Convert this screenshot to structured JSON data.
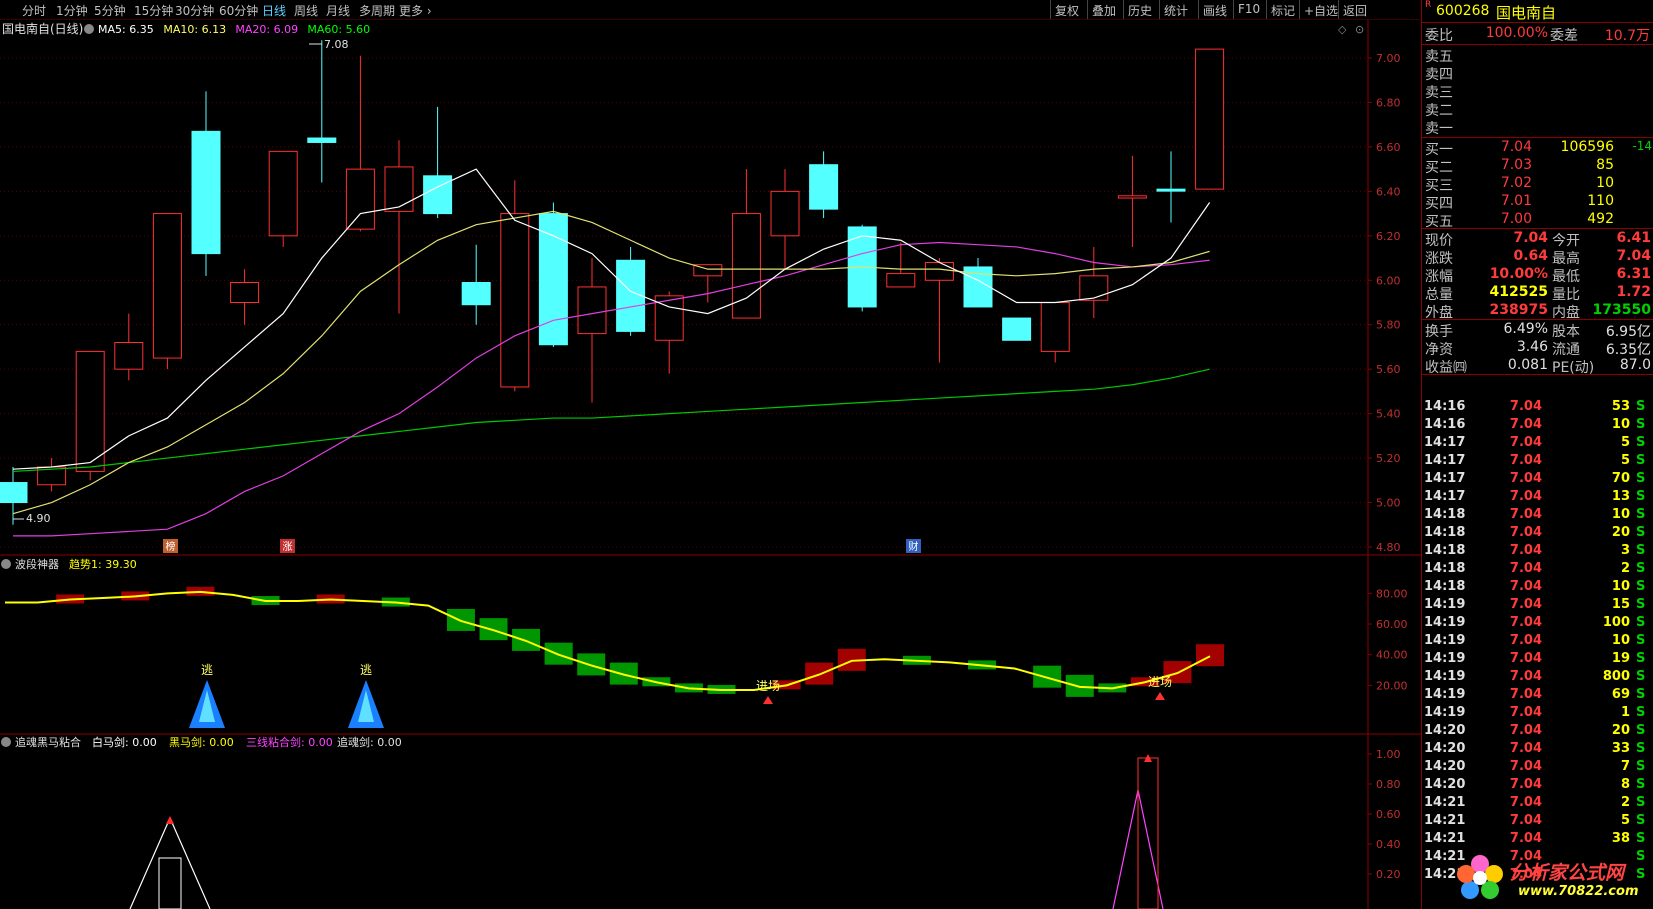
{
  "toolbar": {
    "tabs": [
      "分时",
      "1分钟",
      "5分钟",
      "15分钟",
      "30分钟",
      "60分钟",
      "日线",
      "周线",
      "月线",
      "多周期",
      "更多"
    ],
    "active_tab": "日线",
    "right_buttons": [
      "复权",
      "叠加",
      "历史",
      "统计",
      "画线",
      "F10",
      "标记",
      "+自选",
      "返回"
    ]
  },
  "main_chart": {
    "title": "国电南自(日线)",
    "ma_labels": [
      {
        "text": "MA5: 6.35",
        "color": "#ffffff"
      },
      {
        "text": "MA10: 6.13",
        "color": "#ffff66"
      },
      {
        "text": "MA20: 6.09",
        "color": "#ff44ff"
      },
      {
        "text": "MA60: 5.60",
        "color": "#00ff00"
      }
    ],
    "high_marker": "7.08",
    "low_marker": "4.90",
    "y_ticks": [
      "7.00",
      "6.80",
      "6.60",
      "6.40",
      "6.20",
      "6.00",
      "5.80",
      "5.60",
      "5.40",
      "5.20",
      "5.00",
      "4.80"
    ],
    "flags": [
      "榜",
      "涨",
      "财"
    ]
  },
  "indicator1": {
    "name": "波段神器",
    "value_label": "趋势1: 39.30",
    "y_ticks": [
      "80.00",
      "60.00",
      "40.00",
      "20.00"
    ],
    "signals": [
      "逃",
      "逃",
      "进场",
      "进场"
    ]
  },
  "indicator2": {
    "name": "追魂黑马粘合",
    "values": [
      {
        "text": "白马剑: 0.00",
        "color": "#ffffff"
      },
      {
        "text": "黑马剑: 0.00",
        "color": "#ffff00"
      },
      {
        "text": "三线粘合剑: 0.00",
        "color": "#ff44ff"
      },
      {
        "text": "追魂剑: 0.00",
        "color": "#e0e0e0"
      }
    ],
    "y_ticks": [
      "1.00",
      "0.80",
      "0.60",
      "0.40",
      "0.20"
    ]
  },
  "chart_data": {
    "type": "candlestick",
    "title": "国电南自(日线)",
    "candles": [
      {
        "o": 5.09,
        "h": 5.16,
        "l": 4.9,
        "c": 5.0,
        "up": false
      },
      {
        "o": 5.08,
        "h": 5.2,
        "l": 5.05,
        "c": 5.16,
        "up": true
      },
      {
        "o": 5.14,
        "h": 5.3,
        "l": 5.1,
        "c": 5.68,
        "up": true
      },
      {
        "o": 5.6,
        "h": 5.85,
        "l": 5.55,
        "c": 5.72,
        "up": true
      },
      {
        "o": 5.65,
        "h": 6.2,
        "l": 5.6,
        "c": 6.3,
        "up": true
      },
      {
        "o": 6.67,
        "h": 6.85,
        "l": 6.02,
        "c": 6.12,
        "up": false
      },
      {
        "o": 5.9,
        "h": 6.05,
        "l": 5.8,
        "c": 5.99,
        "up": true
      },
      {
        "o": 6.2,
        "h": 6.58,
        "l": 6.15,
        "c": 6.58,
        "up": true
      },
      {
        "o": 6.64,
        "h": 7.08,
        "l": 6.44,
        "c": 6.62,
        "up": false
      },
      {
        "o": 6.23,
        "h": 7.01,
        "l": 6.22,
        "c": 6.5,
        "up": true
      },
      {
        "o": 6.31,
        "h": 6.63,
        "l": 5.85,
        "c": 6.51,
        "up": true
      },
      {
        "o": 6.47,
        "h": 6.78,
        "l": 6.28,
        "c": 6.3,
        "up": false
      },
      {
        "o": 5.99,
        "h": 6.16,
        "l": 5.8,
        "c": 5.89,
        "up": false
      },
      {
        "o": 5.52,
        "h": 6.45,
        "l": 5.5,
        "c": 6.3,
        "up": true
      },
      {
        "o": 6.3,
        "h": 6.35,
        "l": 5.7,
        "c": 5.71,
        "up": false
      },
      {
        "o": 5.76,
        "h": 6.1,
        "l": 5.45,
        "c": 5.97,
        "up": true
      },
      {
        "o": 6.09,
        "h": 6.15,
        "l": 5.75,
        "c": 5.77,
        "up": false
      },
      {
        "o": 5.73,
        "h": 5.95,
        "l": 5.58,
        "c": 5.93,
        "up": true
      },
      {
        "o": 6.02,
        "h": 6.07,
        "l": 5.9,
        "c": 6.07,
        "up": true
      },
      {
        "o": 5.83,
        "h": 6.5,
        "l": 5.83,
        "c": 6.3,
        "up": true
      },
      {
        "o": 6.2,
        "h": 6.5,
        "l": 6.05,
        "c": 6.4,
        "up": true
      },
      {
        "o": 6.52,
        "h": 6.58,
        "l": 6.28,
        "c": 6.32,
        "up": false
      },
      {
        "o": 6.24,
        "h": 6.25,
        "l": 5.86,
        "c": 5.88,
        "up": false
      },
      {
        "o": 5.97,
        "h": 6.17,
        "l": 5.97,
        "c": 6.03,
        "up": true
      },
      {
        "o": 6.0,
        "h": 6.1,
        "l": 5.63,
        "c": 6.08,
        "up": true
      },
      {
        "o": 6.06,
        "h": 6.1,
        "l": 5.88,
        "c": 5.88,
        "up": false
      },
      {
        "o": 5.83,
        "h": 5.83,
        "l": 5.73,
        "c": 5.73,
        "up": false
      },
      {
        "o": 5.68,
        "h": 5.9,
        "l": 5.63,
        "c": 5.9,
        "up": true
      },
      {
        "o": 5.91,
        "h": 6.15,
        "l": 5.83,
        "c": 6.02,
        "up": true
      },
      {
        "o": 6.37,
        "h": 6.56,
        "l": 6.15,
        "c": 6.38,
        "up": true
      },
      {
        "o": 6.41,
        "h": 6.58,
        "l": 6.26,
        "c": 6.41,
        "up": false
      },
      {
        "o": 6.41,
        "h": 7.04,
        "l": 6.41,
        "c": 7.04,
        "up": true
      }
    ],
    "ma5": [
      5.15,
      5.16,
      5.18,
      5.3,
      5.38,
      5.55,
      5.7,
      5.85,
      6.1,
      6.3,
      6.33,
      6.42,
      6.5,
      6.27,
      6.2,
      6.12,
      5.95,
      5.88,
      5.85,
      5.92,
      6.05,
      6.14,
      6.2,
      6.18,
      6.08,
      6.0,
      5.9,
      5.9,
      5.92,
      5.98,
      6.1,
      6.35
    ],
    "ma10": [
      4.95,
      5.0,
      5.08,
      5.18,
      5.25,
      5.35,
      5.45,
      5.58,
      5.75,
      5.95,
      6.07,
      6.18,
      6.25,
      6.28,
      6.31,
      6.26,
      6.18,
      6.1,
      6.05,
      6.05,
      6.05,
      6.05,
      6.06,
      6.05,
      6.05,
      6.03,
      6.02,
      6.03,
      6.05,
      6.06,
      6.08,
      6.13
    ],
    "ma20": [
      4.85,
      4.85,
      4.86,
      4.87,
      4.88,
      4.95,
      5.05,
      5.12,
      5.22,
      5.32,
      5.4,
      5.52,
      5.65,
      5.75,
      5.82,
      5.85,
      5.88,
      5.91,
      5.94,
      5.98,
      6.02,
      6.07,
      6.12,
      6.16,
      6.17,
      6.16,
      6.15,
      6.12,
      6.08,
      6.06,
      6.07,
      6.09
    ],
    "ma60": [
      5.14,
      5.15,
      5.16,
      5.18,
      5.2,
      5.22,
      5.24,
      5.26,
      5.28,
      5.3,
      5.32,
      5.34,
      5.36,
      5.37,
      5.38,
      5.38,
      5.39,
      5.4,
      5.41,
      5.42,
      5.43,
      5.44,
      5.45,
      5.46,
      5.47,
      5.48,
      5.49,
      5.5,
      5.51,
      5.53,
      5.56,
      5.6
    ],
    "ylim": [
      4.75,
      7.15
    ],
    "trend1": [
      74,
      74,
      76,
      77,
      78,
      80,
      81,
      79,
      75,
      75,
      76,
      75,
      74,
      72,
      62,
      56,
      49,
      40,
      33,
      27,
      22,
      18,
      17,
      17,
      20,
      27,
      36,
      37,
      36,
      35,
      33,
      31,
      25,
      19,
      18,
      22,
      28,
      39
    ],
    "trend1_ylim": [
      0,
      100
    ],
    "ind2_ylim": [
      0,
      1.1
    ]
  },
  "right_panel": {
    "code_mark": "R",
    "code": "600268",
    "name": "国电南自",
    "weibi_label": "委比",
    "weibi": "100.00%",
    "weicha_label": "委差",
    "weicha": "10.7万",
    "asks": [
      {
        "label": "卖五",
        "price": "",
        "vol": ""
      },
      {
        "label": "卖四",
        "price": "",
        "vol": ""
      },
      {
        "label": "卖三",
        "price": "",
        "vol": ""
      },
      {
        "label": "卖二",
        "price": "",
        "vol": ""
      },
      {
        "label": "卖一",
        "price": "",
        "vol": ""
      }
    ],
    "bids": [
      {
        "label": "买一",
        "price": "7.04",
        "vol": "106596",
        "chg": "-14"
      },
      {
        "label": "买二",
        "price": "7.03",
        "vol": "85",
        "chg": ""
      },
      {
        "label": "买三",
        "price": "7.02",
        "vol": "10",
        "chg": ""
      },
      {
        "label": "买四",
        "price": "7.01",
        "vol": "110",
        "chg": ""
      },
      {
        "label": "买五",
        "price": "7.00",
        "vol": "492",
        "chg": ""
      }
    ],
    "quote": [
      {
        "l1": "现价",
        "v1": "7.04",
        "c1": "#ff3b3b",
        "l2": "今开",
        "v2": "6.41",
        "c2": "#ff3b3b"
      },
      {
        "l1": "涨跌",
        "v1": "0.64",
        "c1": "#ff3b3b",
        "l2": "最高",
        "v2": "7.04",
        "c2": "#ff3b3b"
      },
      {
        "l1": "涨幅",
        "v1": "10.00%",
        "c1": "#ff3b3b",
        "l2": "最低",
        "v2": "6.31",
        "c2": "#ff3b3b"
      },
      {
        "l1": "总量",
        "v1": "412525",
        "c1": "#ffff00",
        "l2": "量比",
        "v2": "1.72",
        "c2": "#ff3b3b"
      },
      {
        "l1": "外盘",
        "v1": "238975",
        "c1": "#ff3b3b",
        "l2": "内盘",
        "v2": "173550",
        "c2": "#00d000"
      }
    ],
    "stats": [
      {
        "l1": "换手",
        "v1": "6.49%",
        "l2": "股本",
        "v2": "6.95亿"
      },
      {
        "l1": "净资",
        "v1": "3.46",
        "l2": "流通",
        "v2": "6.35亿"
      },
      {
        "l1": "收益㈣",
        "v1": "0.081",
        "l2": "PE(动)",
        "v2": "87.0"
      }
    ],
    "ticks": [
      {
        "t": "14:16",
        "p": "7.04",
        "v": "53",
        "s": "S"
      },
      {
        "t": "14:16",
        "p": "7.04",
        "v": "10",
        "s": "S"
      },
      {
        "t": "14:17",
        "p": "7.04",
        "v": "5",
        "s": "S"
      },
      {
        "t": "14:17",
        "p": "7.04",
        "v": "5",
        "s": "S"
      },
      {
        "t": "14:17",
        "p": "7.04",
        "v": "70",
        "s": "S"
      },
      {
        "t": "14:17",
        "p": "7.04",
        "v": "13",
        "s": "S"
      },
      {
        "t": "14:18",
        "p": "7.04",
        "v": "10",
        "s": "S"
      },
      {
        "t": "14:18",
        "p": "7.04",
        "v": "20",
        "s": "S"
      },
      {
        "t": "14:18",
        "p": "7.04",
        "v": "3",
        "s": "S"
      },
      {
        "t": "14:18",
        "p": "7.04",
        "v": "2",
        "s": "S"
      },
      {
        "t": "14:18",
        "p": "7.04",
        "v": "10",
        "s": "S"
      },
      {
        "t": "14:19",
        "p": "7.04",
        "v": "15",
        "s": "S"
      },
      {
        "t": "14:19",
        "p": "7.04",
        "v": "100",
        "s": "S"
      },
      {
        "t": "14:19",
        "p": "7.04",
        "v": "10",
        "s": "S"
      },
      {
        "t": "14:19",
        "p": "7.04",
        "v": "19",
        "s": "S"
      },
      {
        "t": "14:19",
        "p": "7.04",
        "v": "800",
        "s": "S"
      },
      {
        "t": "14:19",
        "p": "7.04",
        "v": "69",
        "s": "S"
      },
      {
        "t": "14:19",
        "p": "7.04",
        "v": "1",
        "s": "S"
      },
      {
        "t": "14:20",
        "p": "7.04",
        "v": "20",
        "s": "S"
      },
      {
        "t": "14:20",
        "p": "7.04",
        "v": "33",
        "s": "S"
      },
      {
        "t": "14:20",
        "p": "7.04",
        "v": "7",
        "s": "S"
      },
      {
        "t": "14:20",
        "p": "7.04",
        "v": "8",
        "s": "S"
      },
      {
        "t": "14:21",
        "p": "7.04",
        "v": "2",
        "s": "S"
      },
      {
        "t": "14:21",
        "p": "7.04",
        "v": "5",
        "s": "S"
      },
      {
        "t": "14:21",
        "p": "7.04",
        "v": "38",
        "s": "S"
      },
      {
        "t": "14:21",
        "p": "7.04",
        "v": "",
        "s": "S"
      },
      {
        "t": "14:21",
        "p": "7.04",
        "v": "",
        "s": "S"
      }
    ],
    "watermark": "分析家公式网",
    "watermark_url": "www.70822.com"
  }
}
